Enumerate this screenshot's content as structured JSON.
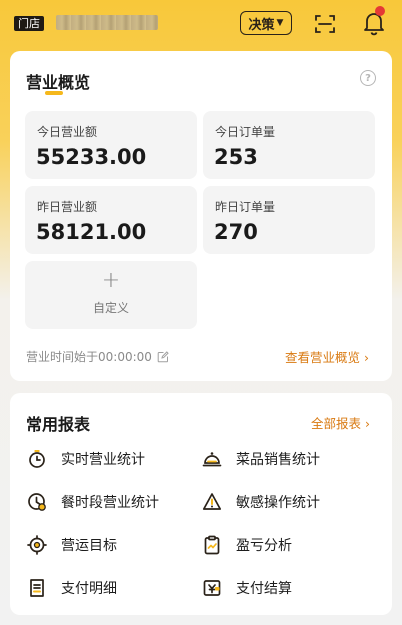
{
  "header": {
    "store_tag": "门店",
    "decision_label": "决策",
    "decision_caret": "▼"
  },
  "overview": {
    "title": "营业概览",
    "help_symbol": "?",
    "stats": [
      {
        "label": "今日营业额",
        "value": "55233.00"
      },
      {
        "label": "今日订单量",
        "value": "253"
      },
      {
        "label": "昨日营业额",
        "value": "58121.00"
      },
      {
        "label": "昨日订单量",
        "value": "270"
      }
    ],
    "custom_plus": "+",
    "custom_label": "自定义",
    "business_time": "营业时间始于00:00:00",
    "view_link": "查看营业概览 ›"
  },
  "reports": {
    "title": "常用报表",
    "all_link": "全部报表 ›",
    "items": [
      {
        "label": "实时营业统计",
        "icon": "timer-icon"
      },
      {
        "label": "菜品销售统计",
        "icon": "dish-cover-icon"
      },
      {
        "label": "餐时段营业统计",
        "icon": "clock-icon"
      },
      {
        "label": "敏感操作统计",
        "icon": "warning-icon"
      },
      {
        "label": "营运目标",
        "icon": "target-icon"
      },
      {
        "label": "盈亏分析",
        "icon": "clipboard-chart-icon"
      },
      {
        "label": "支付明细",
        "icon": "receipt-icon"
      },
      {
        "label": "支付结算",
        "icon": "wallet-icon"
      }
    ]
  },
  "colors": {
    "accent": "#f5b81c",
    "link": "#d97a12",
    "badge": "#e53935"
  }
}
